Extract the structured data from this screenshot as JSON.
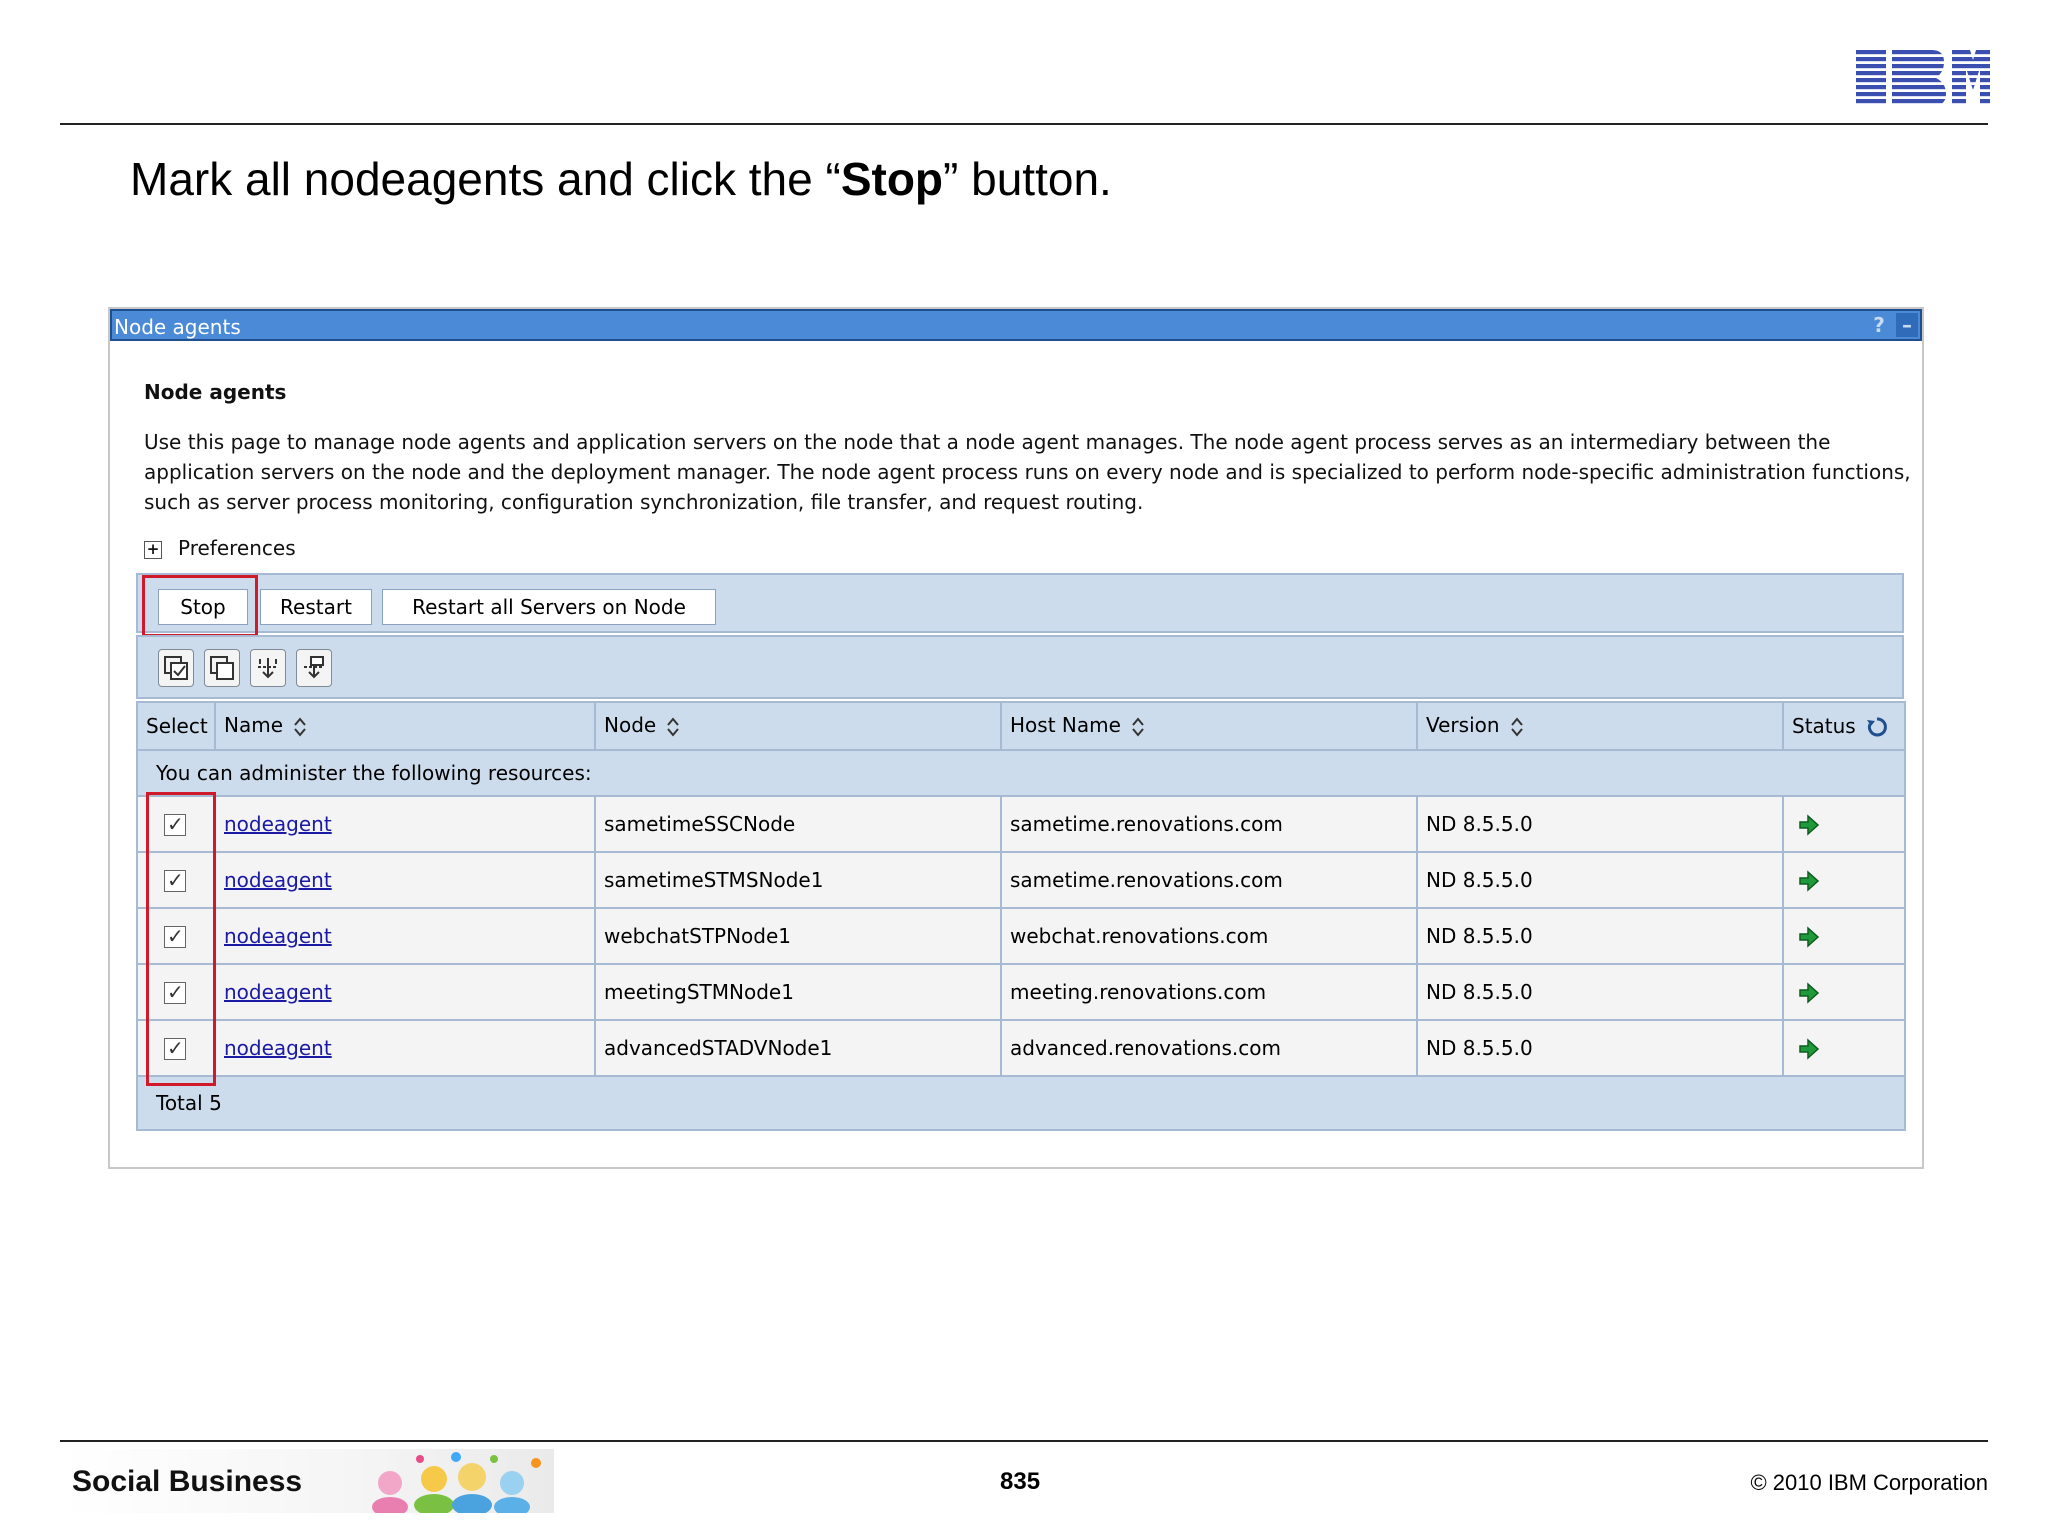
{
  "slide": {
    "title_before": "Mark all nodeagents and click the “",
    "title_bold": "Stop",
    "title_after": "” button.",
    "logo_text": "IBM",
    "footer_brand": "Social Business",
    "page_number": "835",
    "copyright": "© 2010 IBM Corporation"
  },
  "panel": {
    "title": "Node agents",
    "help_button": "?",
    "minimize_button": "–",
    "heading": "Node agents",
    "description": "Use this page to manage node agents and application servers on the node that a node agent manages. The node agent process serves as an intermediary between the application servers on the node and the deployment manager. The node agent process runs on every node and is specialized to perform node-specific administration functions, such as server process monitoring, configuration synchronization, file transfer, and request routing.",
    "preferences_toggle": "+",
    "preferences_label": "Preferences"
  },
  "toolbar": {
    "stop_label": "Stop",
    "restart_label": "Restart",
    "restart_all_label": "Restart all Servers on Node",
    "icons": [
      "select-all-icon",
      "deselect-all-icon",
      "expand-filter-icon",
      "clear-filter-icon"
    ]
  },
  "table": {
    "columns": {
      "select": "Select",
      "name": "Name",
      "node": "Node",
      "host": "Host Name",
      "version": "Version",
      "status": "Status"
    },
    "resources_note": "You can administer the following resources:",
    "rows": [
      {
        "name": "nodeagent",
        "node": "sametimeSSCNode",
        "host": "sametime.renovations.com",
        "version": "ND 8.5.5.0",
        "checked": true,
        "status": "started"
      },
      {
        "name": "nodeagent",
        "node": "sametimeSTMSNode1",
        "host": "sametime.renovations.com",
        "version": "ND 8.5.5.0",
        "checked": true,
        "status": "started"
      },
      {
        "name": "nodeagent",
        "node": "webchatSTPNode1",
        "host": "webchat.renovations.com",
        "version": "ND 8.5.5.0",
        "checked": true,
        "status": "started"
      },
      {
        "name": "nodeagent",
        "node": "meetingSTMNode1",
        "host": "meeting.renovations.com",
        "version": "ND 8.5.5.0",
        "checked": true,
        "status": "started"
      },
      {
        "name": "nodeagent",
        "node": "advancedSTADVNode1",
        "host": "advanced.renovations.com",
        "version": "ND 8.5.5.0",
        "checked": true,
        "status": "started"
      }
    ],
    "total": "Total 5"
  },
  "colors": {
    "titlebar": "#4a8ad6",
    "bar_bg": "#cddcec",
    "highlight": "#d0192a",
    "link": "#1a1aa6",
    "status_arrow": "#1e9a3a",
    "ibm_blue": "#3a4fb0"
  }
}
